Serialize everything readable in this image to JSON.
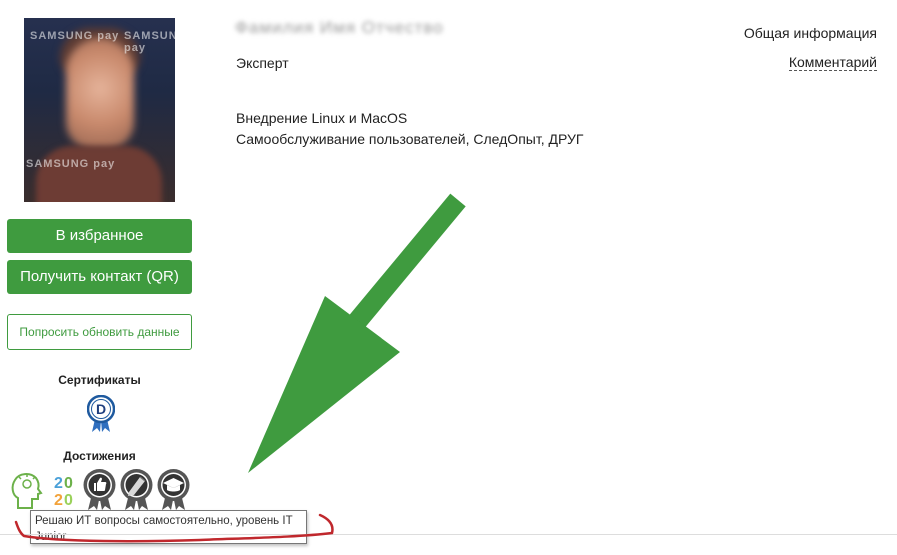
{
  "profile": {
    "name_blurred": "Фамилия Имя Отчество",
    "role": "Эксперт",
    "skills": [
      "Внедрение Linux и MacOS",
      "Самообслуживание пользователей, СледОпыт, ДРУГ"
    ],
    "avatar_watermark": "SAMSUNG pay"
  },
  "links": {
    "general_info": "Общая информация",
    "comment": "Комментарий"
  },
  "actions": {
    "favorite": "В избранное",
    "get_contact": "Получить контакт (QR)",
    "request_update": "Попросить обновить данные"
  },
  "certificates": {
    "title": "Сертификаты",
    "items": [
      {
        "icon": "d-rosette-icon",
        "letter": "D"
      }
    ]
  },
  "achievements": {
    "title": "Достижения",
    "items": [
      {
        "icon": "lightbulb-head-icon",
        "label": ""
      },
      {
        "icon": "year-2020-icon",
        "label": "2020"
      },
      {
        "icon": "thumbs-up-medal-icon",
        "label": ""
      },
      {
        "icon": "pencil-medal-icon",
        "label": ""
      },
      {
        "icon": "graduation-cap-medal-icon",
        "label": ""
      }
    ]
  },
  "tooltip": {
    "text": "Решаю ИТ вопросы самостоятельно, уровень IT Junior"
  },
  "colors": {
    "primary_green": "#3f9b3f",
    "arrow_green": "#3f9b3f",
    "underline_red": "#c0282d",
    "medal_gray": "#555555"
  }
}
